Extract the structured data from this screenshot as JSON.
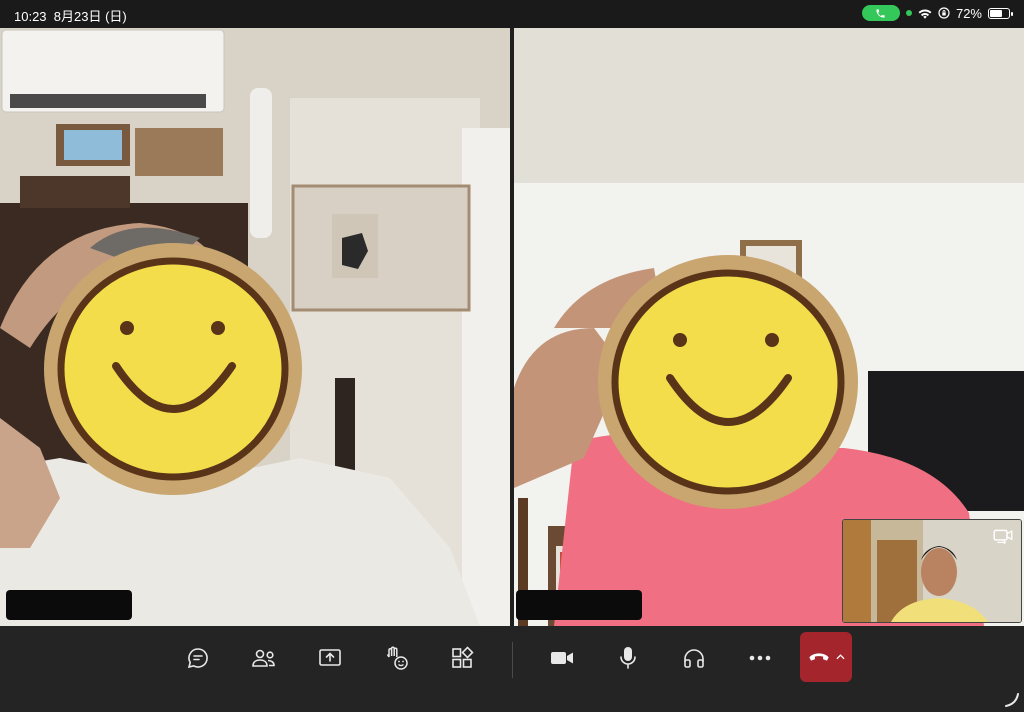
{
  "status_bar": {
    "time": "10:23",
    "date": "8月23日 (日)",
    "battery_percent": "72%",
    "battery_level": 0.72,
    "icons": [
      "phone-icon",
      "wifi-icon",
      "orientation-lock-icon",
      "battery-icon"
    ]
  },
  "tiles": [
    {
      "participant": "left-participant",
      "face_overlay": "smiley-sticker",
      "name_hidden": true
    },
    {
      "participant": "right-participant",
      "face_overlay": "smiley-sticker",
      "name_hidden": true
    }
  ],
  "self_view": {
    "icon": "switch-camera-icon"
  },
  "toolbar": {
    "buttons": [
      {
        "icon": "chat-icon"
      },
      {
        "icon": "people-icon"
      },
      {
        "icon": "share-screen-icon"
      },
      {
        "icon": "reactions-icon"
      },
      {
        "icon": "apps-icon"
      },
      {
        "icon": "camera-icon"
      },
      {
        "icon": "microphone-icon"
      },
      {
        "icon": "headphones-icon"
      },
      {
        "icon": "more-icon"
      },
      {
        "icon": "hang-up-icon"
      },
      {
        "icon": "chevron-up-icon"
      }
    ]
  },
  "colors": {
    "status_green": "#34c759",
    "hangup_red": "#a4262c",
    "toolbar_bg": "#242424",
    "smiley_yellow": "#f4dd4a",
    "smiley_brown": "#5a3418"
  }
}
